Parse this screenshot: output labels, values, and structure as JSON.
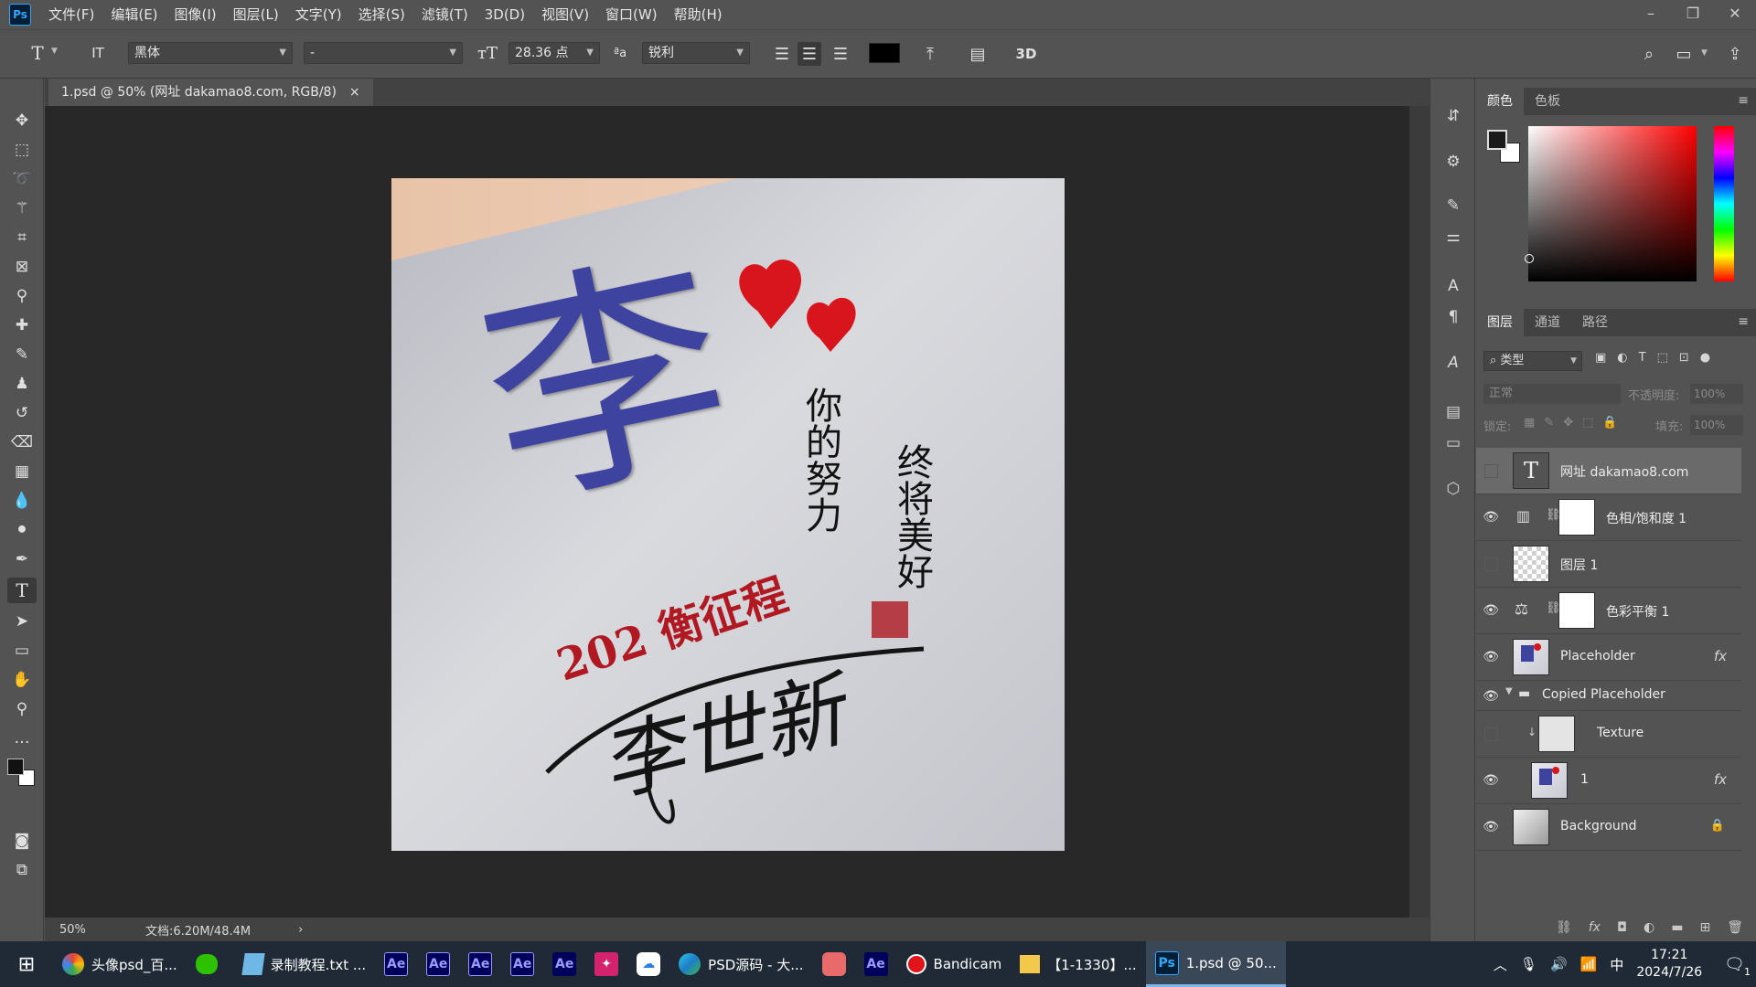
{
  "app": {
    "logo": "Ps"
  },
  "menu": [
    "文件(F)",
    "编辑(E)",
    "图像(I)",
    "图层(L)",
    "文字(Y)",
    "选择(S)",
    "滤镜(T)",
    "3D(D)",
    "视图(V)",
    "窗口(W)",
    "帮助(H)"
  ],
  "window_controls": {
    "minimize": "–",
    "restore": "❐",
    "close": "✕"
  },
  "options": {
    "tool_glyph": "T",
    "orientation_glyph": "IT",
    "font_family": "黑体",
    "font_style": "-",
    "font_size": "28.36 点",
    "aa_label": "ªa",
    "antialias": "锐利",
    "color_hex": "#000000",
    "three_d": "3D"
  },
  "document": {
    "tab_title": "1.psd @ 50% (网址 dakamao8.com, RGB/8)",
    "tab_close": "×",
    "zoom": "50%",
    "doc_size": "文档:6.20M/48.4M",
    "status_arrow": "›"
  },
  "artwork": {
    "big_char": "李",
    "poem_col1": "你的努力",
    "poem_col2": "终将美好",
    "slogan": "202 衡征程",
    "signature": "李世新"
  },
  "color_panel": {
    "tabs": [
      "颜色",
      "色板"
    ],
    "foreground": "#1a1a1a",
    "background": "#ffffff"
  },
  "layers_panel": {
    "tabs": [
      "图层",
      "通道",
      "路径"
    ],
    "filter_kind": "类型",
    "blend_mode": "正常",
    "opacity_label": "不透明度:",
    "opacity": "100%",
    "lock_label": "锁定:",
    "fill_label": "填充:",
    "fill": "100%",
    "layers": [
      {
        "name": "网址 dakamao8.com",
        "visible": false,
        "selected": true
      },
      {
        "name": "色相/饱和度 1",
        "visible": true
      },
      {
        "name": "图层 1",
        "visible": false
      },
      {
        "name": "色彩平衡 1",
        "visible": true
      },
      {
        "name": "Placeholder",
        "visible": true,
        "fx": "fx"
      },
      {
        "name": "Copied Placeholder",
        "visible": true
      },
      {
        "name": "Texture",
        "visible": false
      },
      {
        "name": "1",
        "visible": true,
        "fx": "fx"
      },
      {
        "name": "Background",
        "visible": true
      }
    ]
  },
  "taskbar": {
    "items": [
      {
        "label": "头像psd_百..."
      },
      {
        "label": ""
      },
      {
        "label": "录制教程.txt ..."
      },
      {
        "label": "Ae"
      },
      {
        "label": "Ae"
      },
      {
        "label": "Ae"
      },
      {
        "label": "Ae"
      },
      {
        "label": "Ae"
      },
      {
        "label": "PSD源码 - 大..."
      },
      {
        "label": "Ae"
      },
      {
        "label": "Bandicam"
      },
      {
        "label": "【1-1330】..."
      },
      {
        "label": "1.psd @ 50..."
      }
    ],
    "ime": "中",
    "time": "17:21",
    "date": "2024/7/26",
    "notifications": "1"
  }
}
